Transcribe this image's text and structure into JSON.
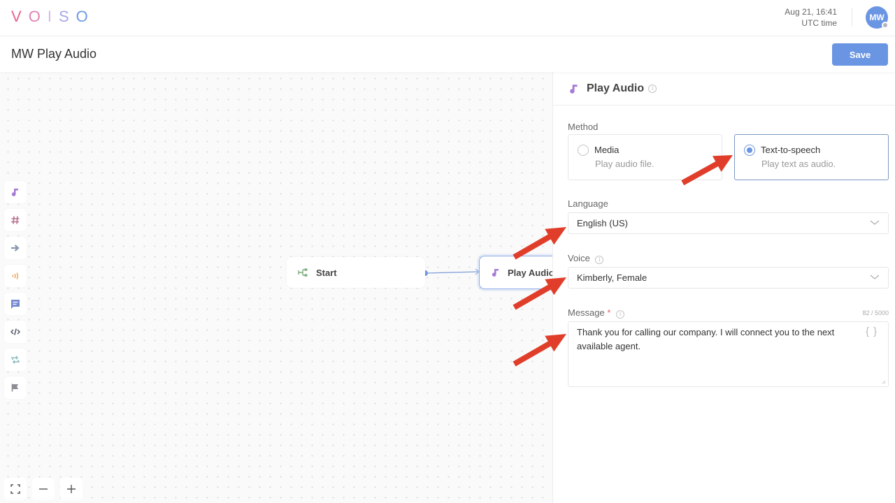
{
  "app": {
    "logo_letters": [
      {
        "char": "V",
        "color": "#e8658f"
      },
      {
        "char": "O",
        "color": "#e383b2"
      },
      {
        "char": "I",
        "color": "#d6b7ea"
      },
      {
        "char": "S",
        "color": "#a9a6ec"
      },
      {
        "char": "O",
        "color": "#6f99e6"
      }
    ],
    "datetime": "Aug 21, 16:41",
    "timezone": "UTC time",
    "user_initials": "MW",
    "accent_color": "#6a95e3"
  },
  "page": {
    "title": "MW Play Audio",
    "save_label": "Save"
  },
  "canvas": {
    "toolbox": [
      {
        "icon": "music-note-icon",
        "color": "#a57ad6"
      },
      {
        "icon": "hash-icon",
        "color": "#b8708e"
      },
      {
        "icon": "arrow-right-icon",
        "color": "#8a97ad"
      },
      {
        "icon": "sound-waves-icon",
        "color": "#ebaa5a"
      },
      {
        "icon": "message-icon",
        "color": "#7489cf"
      },
      {
        "icon": "code-icon",
        "color": "#4f5564"
      },
      {
        "icon": "loop-icon",
        "color": "#8fbfc0"
      },
      {
        "icon": "flag-icon",
        "color": "#8d8d96"
      }
    ],
    "nodes": [
      {
        "label": "Start",
        "icon": "flow-start-icon"
      },
      {
        "label": "Play Audio",
        "icon": "music-note-icon"
      }
    ],
    "zoom_controls": [
      "fit-screen-icon",
      "zoom-out-icon",
      "zoom-in-icon"
    ]
  },
  "panel": {
    "title": "Play Audio",
    "method_label": "Method",
    "methods": [
      {
        "title": "Media",
        "subtitle": "Play audio file.",
        "selected": false
      },
      {
        "title": "Text-to-speech",
        "subtitle": "Play text as audio.",
        "selected": true
      }
    ],
    "language_label": "Language",
    "language_value": "English (US)",
    "voice_label": "Voice",
    "voice_value": "Kimberly, Female",
    "message_label": "Message",
    "message_required": "*",
    "message_counter": "82 / 5000",
    "message_value": "Thank you for calling our company. I will connect you to the next available agent.",
    "variables_button": "{ }"
  }
}
